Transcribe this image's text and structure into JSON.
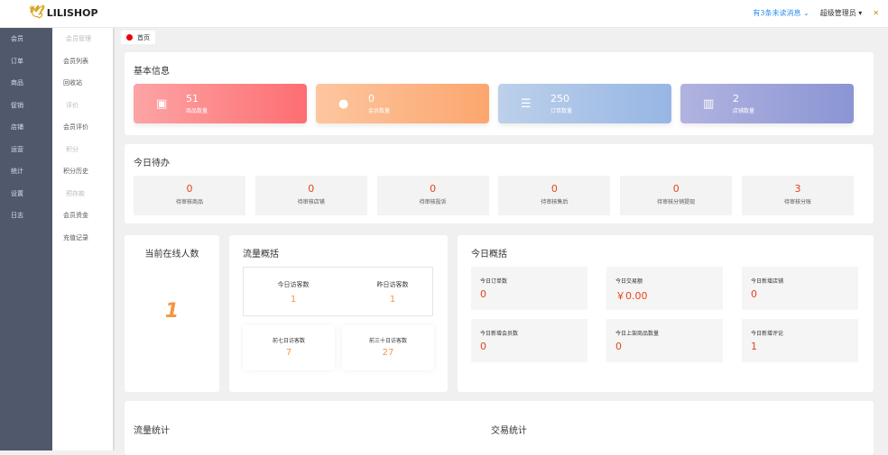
{
  "header": {
    "logo": "LILISHOP",
    "messages": "有3条未读消息",
    "user": "超级管理员"
  },
  "sidebar": [
    "会员",
    "订单",
    "商品",
    "促销",
    "店铺",
    "运营",
    "统计",
    "设置",
    "日志"
  ],
  "submenu": [
    {
      "t": "会员管理",
      "g": true
    },
    {
      "t": "会员列表"
    },
    {
      "t": "回收站"
    },
    {
      "t": "评价",
      "g": true
    },
    {
      "t": "会员评价"
    },
    {
      "t": "积分",
      "g": true
    },
    {
      "t": "积分历史"
    },
    {
      "t": "预存款",
      "g": true
    },
    {
      "t": "会员资金"
    },
    {
      "t": "充值记录"
    }
  ],
  "tab": "首页",
  "basic": {
    "title": "基本信息",
    "stats": [
      {
        "n": "51",
        "l": "商品数量"
      },
      {
        "n": "0",
        "l": "会员数量"
      },
      {
        "n": "250",
        "l": "订单数量"
      },
      {
        "n": "2",
        "l": "店铺数量"
      }
    ]
  },
  "todo": {
    "title": "今日待办",
    "items": [
      {
        "n": "0",
        "l": "待审核商品"
      },
      {
        "n": "0",
        "l": "待审核店铺"
      },
      {
        "n": "0",
        "l": "待审核投诉"
      },
      {
        "n": "0",
        "l": "待审核售后"
      },
      {
        "n": "0",
        "l": "待审核分销提现"
      },
      {
        "n": "3",
        "l": "待审核分账"
      }
    ]
  },
  "online": {
    "title": "当前在线人数",
    "value": "1"
  },
  "traffic": {
    "title": "流量概括",
    "today_l": "今日访客数",
    "today": "1",
    "yest_l": "昨日访客数",
    "yest": "1",
    "w_l": "前七日访客数",
    "w": "7",
    "m_l": "前三十日访客数",
    "m": "27"
  },
  "overview": {
    "title": "今日概括",
    "items": [
      {
        "l": "今日订单数",
        "n": "0"
      },
      {
        "l": "今日交易额",
        "n": "￥0.00"
      },
      {
        "l": "今日新增店铺",
        "n": "0"
      },
      {
        "l": "今日新增会员数",
        "n": "0"
      },
      {
        "l": "今日上架商品数量",
        "n": "0"
      },
      {
        "l": "今日新增评论",
        "n": "1"
      }
    ]
  },
  "bottom": {
    "traffic_stats": "流量统计",
    "trade_stats": "交易统计"
  }
}
